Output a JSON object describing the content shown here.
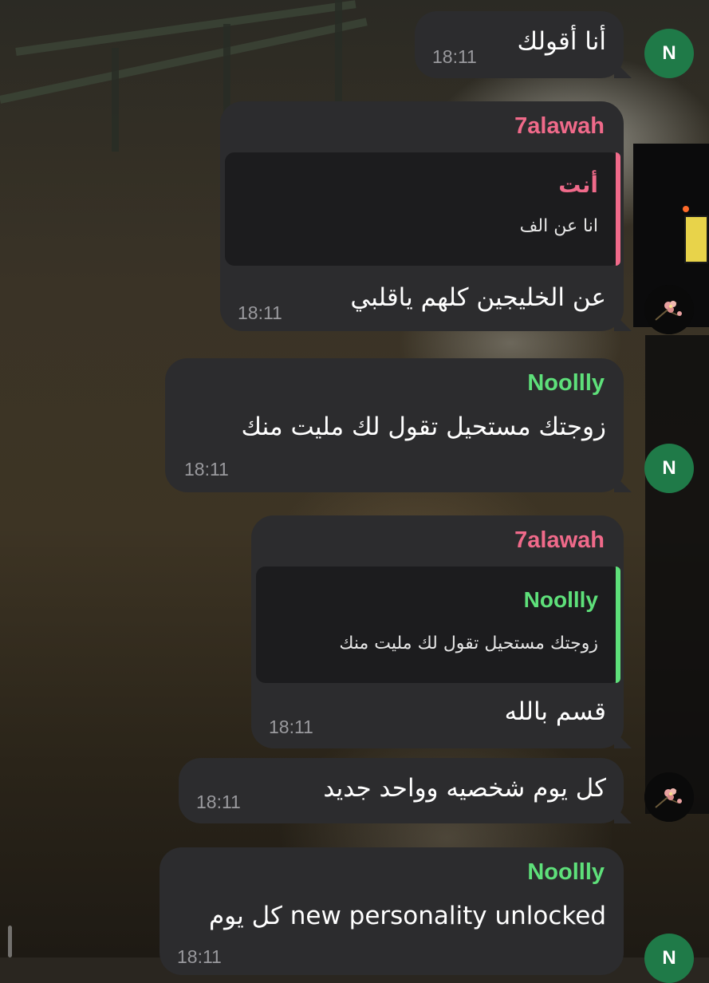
{
  "colors": {
    "bubble_bg": "#2c2c2e",
    "reply_bg": "#1c1c1e",
    "pink_name": "#f06a8a",
    "green_name": "#5ee07a",
    "time_text": "#9a9a9e",
    "avatar_green": "#1f7a48"
  },
  "messages": [
    {
      "text": "أنا أقولك",
      "time": "18:11",
      "avatar": "N"
    },
    {
      "sender": "7alawah",
      "reply": {
        "name": "أنت",
        "text": "انا عن الف"
      },
      "text": "عن الخليجين كلهم ياقلبي",
      "time": "18:11",
      "avatar_icon": "flower-icon"
    },
    {
      "sender": "Noollly",
      "text": "زوجتك مستحيل تقول لك مليت منك",
      "time": "18:11",
      "avatar": "N"
    },
    {
      "sender": "7alawah",
      "reply": {
        "name": "Noollly",
        "text": "زوجتك مستحيل تقول لك مليت منك"
      },
      "text": "قسم بالله",
      "time": "18:11"
    },
    {
      "text": "كل يوم شخصيه وواحد جديد",
      "time": "18:11",
      "avatar_icon": "flower-icon"
    },
    {
      "sender": "Noollly",
      "text": "new personality unlocked كل يوم",
      "time": "18:11",
      "avatar": "N"
    }
  ]
}
